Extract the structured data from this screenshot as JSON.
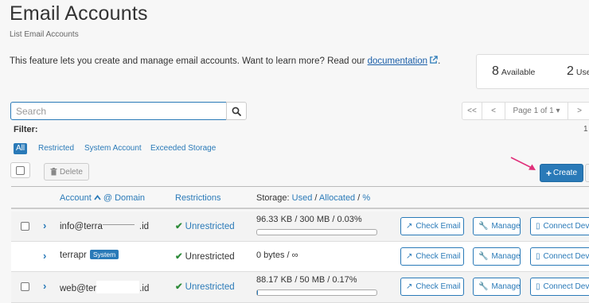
{
  "header": {
    "title": "Email Accounts",
    "subtitle": "List Email Accounts",
    "intro_text": "This feature lets you create and manage email accounts. Want to learn more? Read our",
    "doc_link": "documentation",
    "intro_end": "."
  },
  "stats": {
    "available_count": "8",
    "available_label": "Available",
    "used_count": "2",
    "used_label": "Use"
  },
  "search": {
    "placeholder": "Search"
  },
  "pagination": {
    "first": "<<",
    "prev": "<",
    "page_label": "Page 1 of 1 ▾",
    "next": ">",
    "count": "1"
  },
  "filter": {
    "label": "Filter:",
    "options": [
      "All",
      "Restricted",
      "System Account",
      "Exceeded Storage"
    ],
    "active": "All"
  },
  "toolbar": {
    "delete_label": "Delete",
    "create_label": "Create"
  },
  "table": {
    "headers": {
      "account": "Account",
      "at_domain": "@ Domain",
      "restrictions": "Restrictions",
      "storage_prefix": "Storage:",
      "used": "Used",
      "allocated": "Allocated",
      "percent": "%"
    },
    "rows": [
      {
        "account": "info@terra",
        "account_suffix": ".id",
        "restriction": "Unrestricted",
        "storage": "96.33 KB / 300 MB / 0.03%",
        "usage_fraction": 0.0003
      },
      {
        "account": "terrapr",
        "badge": "System",
        "restriction": "Unrestricted",
        "storage": "0 bytes / ∞"
      },
      {
        "account": "web@ter",
        "account_suffix": ".id",
        "restriction": "Unrestricted",
        "storage": "88.17 KB / 50 MB / 0.17%",
        "usage_fraction": 0.0017
      }
    ],
    "actions": {
      "check_email": "Check Email",
      "manage": "Manage",
      "connect": "Connect Dev"
    }
  },
  "colors": {
    "primary": "#2a7ab8",
    "success": "#2e8b3a",
    "annotation_arrow": "#e0307a"
  }
}
